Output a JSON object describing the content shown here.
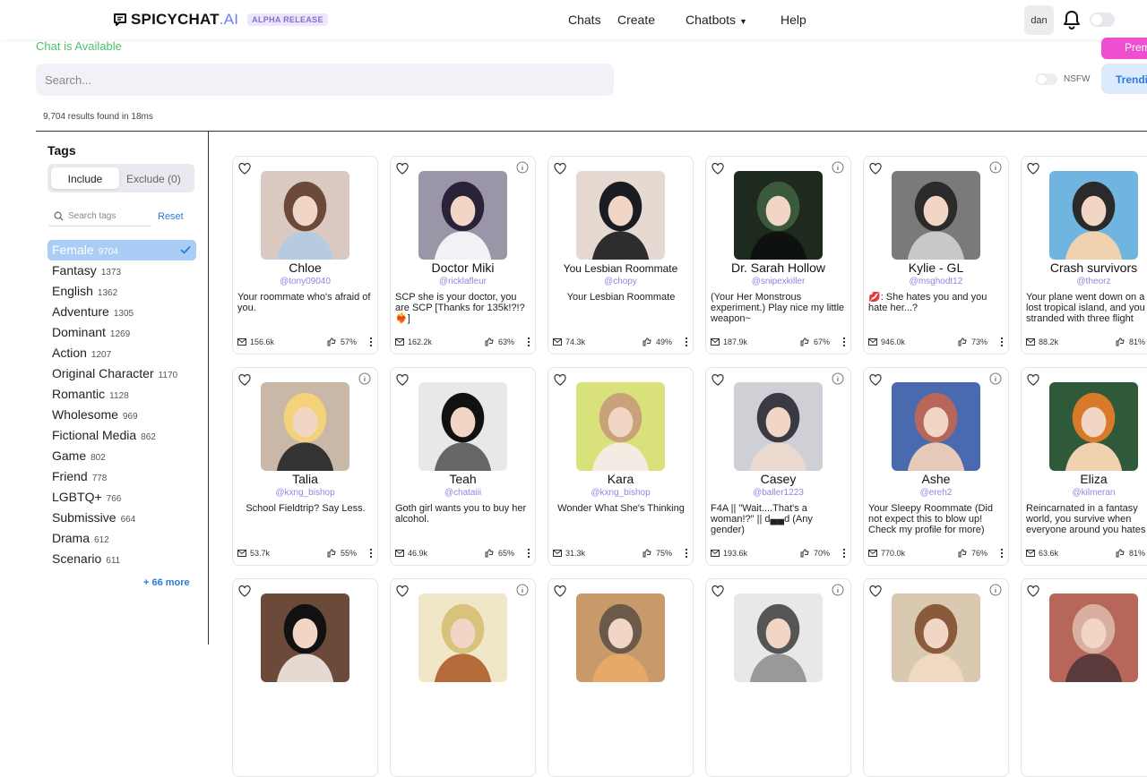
{
  "header": {
    "logo_text": "SPICYCHAT",
    "logo_ai": ".AI",
    "badge": "ALPHA RELEASE",
    "nav": [
      {
        "label": "Chats"
      },
      {
        "label": "Create"
      },
      {
        "label": "Chatbots"
      },
      {
        "label": "Help"
      }
    ],
    "user": "dan"
  },
  "status": "Chat is Available",
  "search": {
    "placeholder": "Search..."
  },
  "nsfw_label": "NSFW",
  "premium_label": "Prem",
  "trending_label": "Trendi",
  "results_text": "9,704 results found in 18ms",
  "sidebar": {
    "title": "Tags",
    "include_label": "Include",
    "exclude_label": "Exclude (0)",
    "search_placeholder": "Search tags",
    "reset_label": "Reset",
    "more_label": "+ 66 more",
    "tags": [
      {
        "name": "Female",
        "count": "9704"
      },
      {
        "name": "Fantasy",
        "count": "1373"
      },
      {
        "name": "English",
        "count": "1362"
      },
      {
        "name": "Adventure",
        "count": "1305"
      },
      {
        "name": "Dominant",
        "count": "1269"
      },
      {
        "name": "Action",
        "count": "1207"
      },
      {
        "name": "Original Character",
        "count": "1170"
      },
      {
        "name": "Romantic",
        "count": "1128"
      },
      {
        "name": "Wholesome",
        "count": "969"
      },
      {
        "name": "Fictional Media",
        "count": "862"
      },
      {
        "name": "Game",
        "count": "802"
      },
      {
        "name": "Friend",
        "count": "778"
      },
      {
        "name": "LGBTQ+",
        "count": "766"
      },
      {
        "name": "Submissive",
        "count": "664"
      },
      {
        "name": "Drama",
        "count": "612"
      },
      {
        "name": "Scenario",
        "count": "611"
      }
    ]
  },
  "cards": [
    {
      "name": "Chloe",
      "handle": "@tony09040",
      "desc": "Your roommate who's afraid of you.",
      "messages": "156.6k",
      "rating": "57%"
    },
    {
      "name": "Doctor Miki",
      "handle": "@ricklafleur",
      "desc": "SCP she is your doctor, you are SCP [Thanks for 135k!?!?❤️‍🔥]",
      "messages": "162.2k",
      "rating": "63%"
    },
    {
      "name": "You Lesbian Roommate",
      "handle": "@chopy",
      "desc": "Your Lesbian Roommate",
      "messages": "74.3k",
      "rating": "49%"
    },
    {
      "name": "Dr. Sarah Hollow",
      "handle": "@snipexkiller",
      "desc": "(Your Her Monstrous experiment.) Play nice my little weapon~",
      "messages": "187.9k",
      "rating": "67%"
    },
    {
      "name": "Kylie - GL",
      "handle": "@msghodt12",
      "desc": "💋: She hates you and you hate her...?",
      "messages": "946.0k",
      "rating": "73%"
    },
    {
      "name": "Crash survivors",
      "handle": "@theorz",
      "desc": "Your plane went down on a lost tropical island, and you are stranded with three flight attendants",
      "messages": "88.2k",
      "rating": "81%"
    },
    {
      "name": "Talia",
      "handle": "@kxng_bishop",
      "desc": "School Fieldtrip? Say Less.",
      "messages": "53.7k",
      "rating": "55%"
    },
    {
      "name": "Teah",
      "handle": "@chataiii",
      "desc": "Goth girl wants you to buy her alcohol.",
      "messages": "46.9k",
      "rating": "65%"
    },
    {
      "name": "Kara",
      "handle": "@kxng_bishop",
      "desc": "Wonder What She's Thinking",
      "messages": "31.3k",
      "rating": "75%"
    },
    {
      "name": "Casey",
      "handle": "@baller1223",
      "desc": "F4A || \"Wait....That's a woman!?\" || d▄▄d (Any gender)",
      "messages": "193.6k",
      "rating": "70%"
    },
    {
      "name": "Ashe",
      "handle": "@ereh2",
      "desc": "Your Sleepy Roommate (Did not expect this to blow up! Check my profile for more)",
      "messages": "770.0k",
      "rating": "76%"
    },
    {
      "name": "Eliza",
      "handle": "@kilmeran",
      "desc": "Reincarnated in a fantasy world, you survive when everyone around you hates humans?",
      "messages": "63.6k",
      "rating": "81%"
    }
  ]
}
